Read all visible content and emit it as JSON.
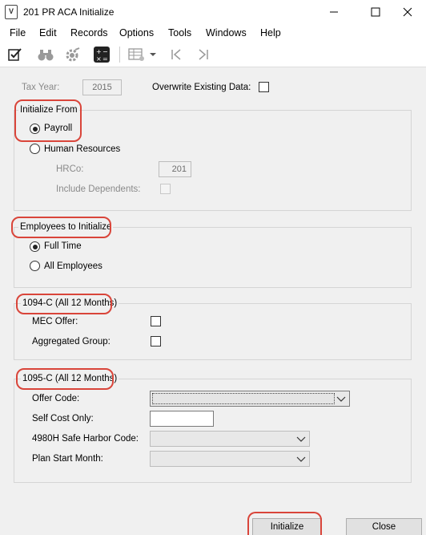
{
  "window": {
    "title": "201 PR ACA Initialize",
    "icon": "document-v-icon"
  },
  "menu": [
    "File",
    "Edit",
    "Records",
    "Options",
    "Tools",
    "Windows",
    "Help"
  ],
  "toolbar": {
    "icons": [
      "edit-check-icon",
      "binoculars-icon",
      "gear-icon",
      "calculator-icon",
      "table-settings-icon",
      "dropdown-arrow-icon",
      "first-record-icon",
      "last-record-icon"
    ]
  },
  "form": {
    "tax_year_label": "Tax Year:",
    "tax_year_value": "2015",
    "overwrite_label": "Overwrite Existing Data:",
    "initialize_from": {
      "title": "Initialize From",
      "payroll_label": "Payroll",
      "hr_label": "Human Resources",
      "hrco_label": "HRCo:",
      "hrco_value": "201",
      "include_dependents_label": "Include Dependents:",
      "selected": "Payroll"
    },
    "employees": {
      "title": "Employees to Initialize",
      "full_time_label": "Full Time",
      "all_label": "All Employees",
      "selected": "Full Time"
    },
    "form_1094c": {
      "title": "1094-C (All 12 Months)",
      "mec_label": "MEC Offer:",
      "aggregated_label": "Aggregated Group:"
    },
    "form_1095c": {
      "title": "1095-C (All 12 Months)",
      "offer_code_label": "Offer Code:",
      "self_cost_label": "Self Cost Only:",
      "safe_harbor_label": "4980H Safe Harbor Code:",
      "plan_start_label": "Plan Start Month:"
    }
  },
  "buttons": {
    "initialize": "Initialize",
    "close": "Close"
  },
  "colors": {
    "highlight": "#d9453a",
    "background": "#f0f0f0"
  }
}
